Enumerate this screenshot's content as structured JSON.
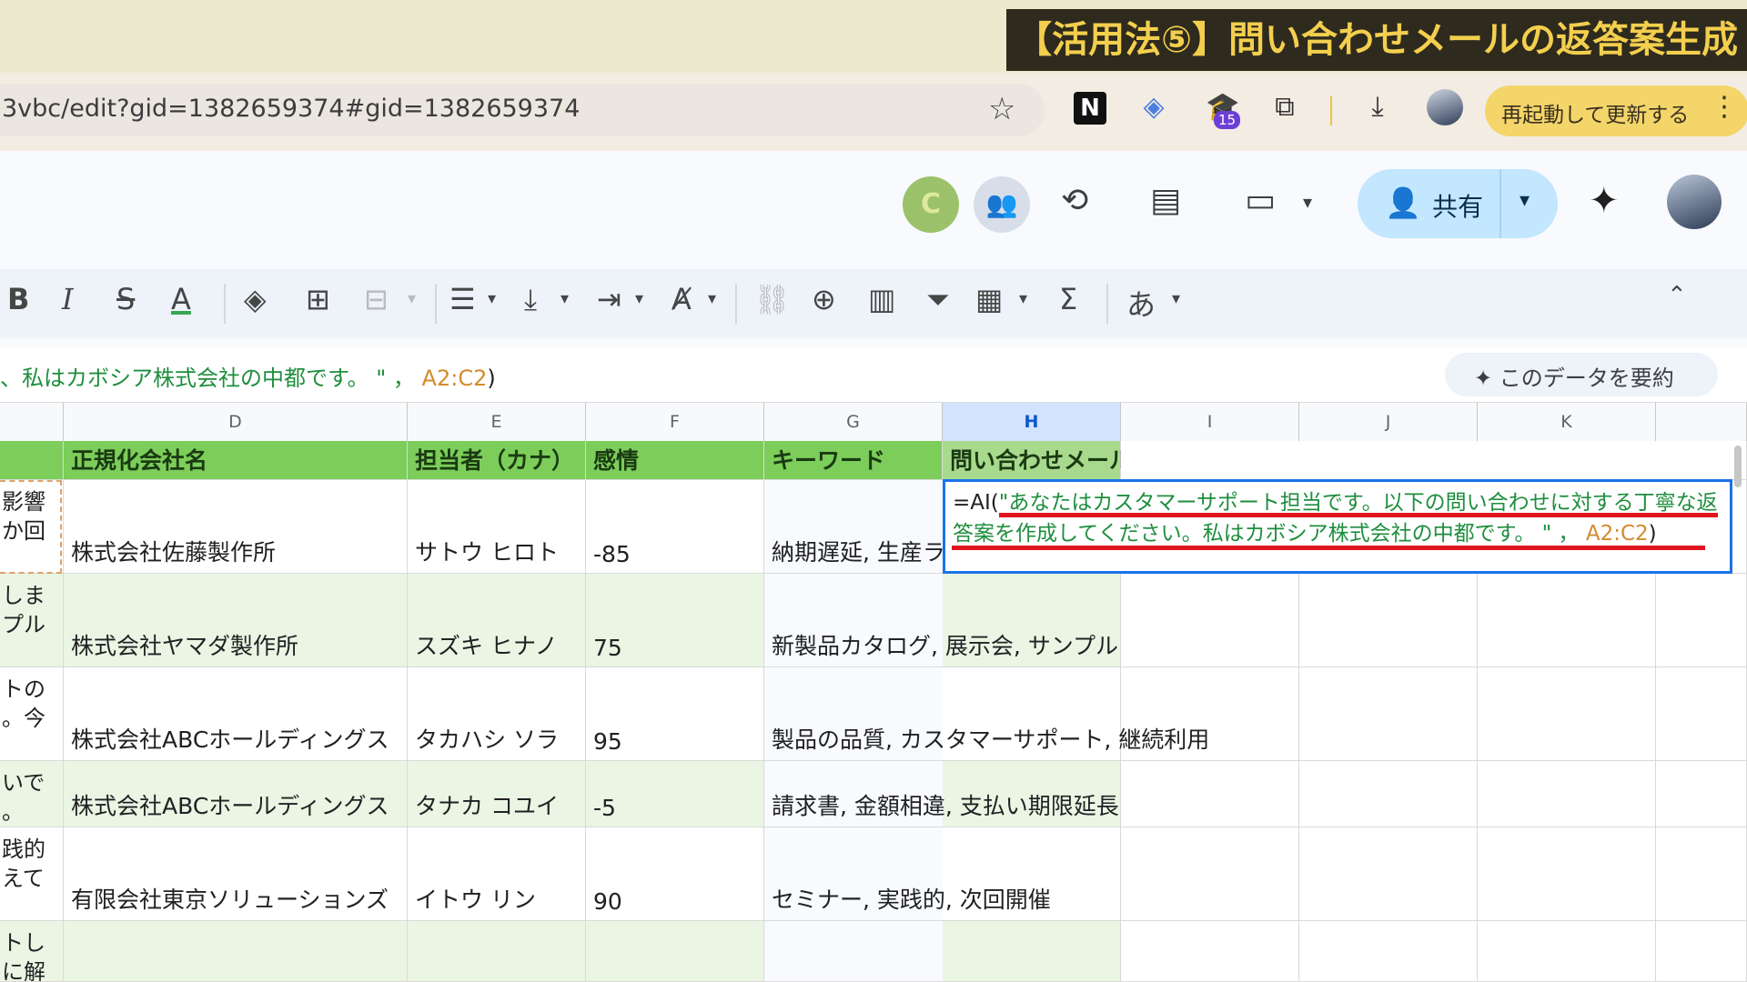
{
  "caption": "【活用法⑤】問い合わせメールの返答案生成",
  "browser": {
    "url": "3vbc/edit?gid=1382659374#gid=1382659374",
    "extension_badge": "15",
    "restart_label": "再起動して更新する",
    "icons": [
      "star-icon",
      "notion-icon",
      "tag-icon",
      "graduation-cap-icon",
      "puzzle-icon",
      "download-icon",
      "profile-icon",
      "more-vert-icon"
    ]
  },
  "app": {
    "share_label": "共有",
    "collab_initial": "C",
    "icons": [
      "history-icon",
      "comment-icon",
      "meet-icon",
      "gemini-icon"
    ]
  },
  "toolbar": {
    "bold": "B",
    "italic": "I",
    "strike": "S",
    "textcolor": "A",
    "input_tools": "あ"
  },
  "formula_bar": {
    "text": "、私はカボシア株式会社の中都です。 \" ，",
    "range": "A2:C2",
    "close": ")",
    "summarize_label": "このデータを要約"
  },
  "grid": {
    "columns": [
      "D",
      "E",
      "F",
      "G",
      "H",
      "I",
      "J",
      "K"
    ],
    "header_row": [
      "正規化会社名",
      "担当者（カナ）",
      "感情",
      "キーワード",
      "問い合わせメール"
    ],
    "left_clip": [
      [
        "影響",
        "か回"
      ],
      [
        "しま",
        "プル"
      ],
      [
        "トの",
        "。今"
      ],
      [
        "いで",
        "。"
      ],
      [
        "践的",
        "えて"
      ],
      [
        "トし",
        "に解"
      ]
    ],
    "rows": [
      {
        "company": "株式会社佐藤製作所",
        "contact": "サトウ ヒロト",
        "sentiment": "-85",
        "keywords": "納期遅延, 生産ラ"
      },
      {
        "company": "株式会社ヤマダ製作所",
        "contact": "スズキ ヒナノ",
        "sentiment": "75",
        "keywords": "新製品カタログ, 展示会, サンプル"
      },
      {
        "company": "株式会社ABCホールディングス",
        "contact": "タカハシ ソラ",
        "sentiment": "95",
        "keywords": "製品の品質, カスタマーサポート, 継続利用"
      },
      {
        "company": "株式会社ABCホールディングス",
        "contact": "タナカ コユイ",
        "sentiment": "-5",
        "keywords": "請求書, 金額相違, 支払い期限延長"
      },
      {
        "company": "有限会社東京ソリューションズ",
        "contact": "イトウ リン",
        "sentiment": "90",
        "keywords": "セミナー, 実践的, 次回開催"
      },
      {
        "company": "",
        "contact": "",
        "sentiment": "",
        "keywords": ""
      }
    ],
    "active_cell_formula": {
      "prefix": "=AI(",
      "prompt": "\"あなたはカスタマーサポート担当です。以下の問い合わせに対する丁寧な返答案を作成してください。私はカボシア株式会社の中都です。 \" ，",
      "range": "A2:C2",
      "close": ")"
    }
  }
}
